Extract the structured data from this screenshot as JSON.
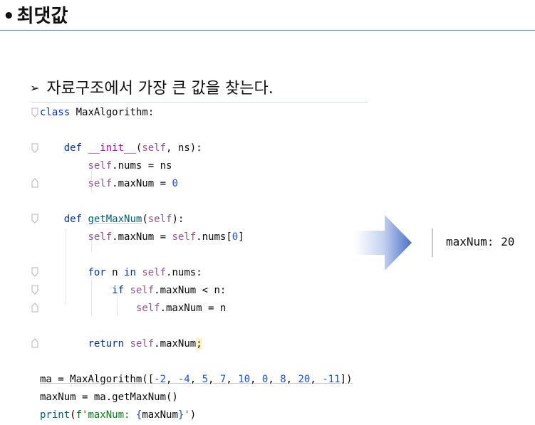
{
  "heading": {
    "bullet": "•",
    "text": "최댓값"
  },
  "subheading": {
    "marker": "➢",
    "text": "자료구조에서 가장 큰 값을 찾는다."
  },
  "code": {
    "l1_kw": "class",
    "l1_rest": " MaxAlgorithm:",
    "l3_def": "def",
    "l3_name": "__init__",
    "l3_self": "self",
    "l3_rest": ", ns):",
    "l4_self": "self",
    "l4_rest": ".nums = ns",
    "l5_self": "self",
    "l5_rest": ".maxNum = ",
    "l5_num": "0",
    "l7_def": "def",
    "l7_name": "getMaxNum",
    "l7_self": "self",
    "l7_rest": "):",
    "l8_self": "self",
    "l8_mid": ".maxNum = ",
    "l8_self2": "self",
    "l8_rest": ".nums[",
    "l8_num": "0",
    "l8_end": "]",
    "l10_for": "for",
    "l10_n": " n ",
    "l10_in": "in",
    "l10_self": "self",
    "l10_rest": ".nums:",
    "l11_if": "if",
    "l11_self": "self",
    "l11_rest": ".maxNum < n:",
    "l12_self": "self",
    "l12_rest": ".maxNum = n",
    "l14_return": "return",
    "l14_self": "self",
    "l14_rest": ".maxNum",
    "l14_semi": ";",
    "l16_start": "ma = MaxAlgorithm([",
    "l16_nums": [
      "-2",
      "-4",
      "5",
      "7",
      "10",
      "0",
      "8",
      "20",
      "-11"
    ],
    "l16_sep": ", ",
    "l16_end": "])",
    "l17": "maxNum = ma.getMaxNum()",
    "l18_print": "print",
    "l18_open": "(",
    "l18_str1": "f'maxNum: ",
    "l18_brace1": "{",
    "l18_var": "maxNum",
    "l18_brace2": "}",
    "l18_str2": "'",
    "l18_close": ")"
  },
  "output": {
    "text": "maxNum: 20"
  }
}
